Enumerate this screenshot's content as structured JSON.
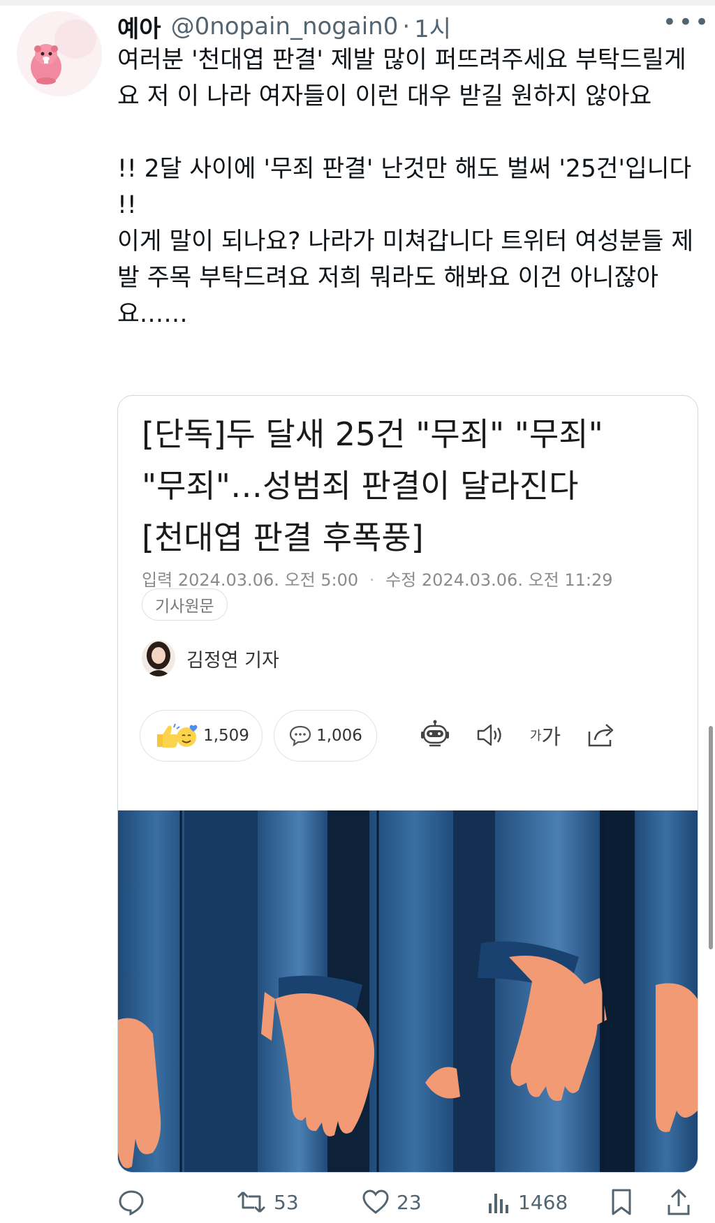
{
  "tweet": {
    "author_name": "예아",
    "handle": "@0nopain_nogain0",
    "separator": "·",
    "time": "1시",
    "more": "•••",
    "paragraphs": [
      "여러분 '천대엽 판결' 제발 많이 퍼뜨려주세요 부탁드릴게요 저 이 나라 여자들이 이런 대우 받길 원하지 않아요",
      "",
      "!! 2달 사이에 '무죄 판결' 난것만 해도 벌써 '25건'입니다 !!",
      "이게 말이 되나요? 나라가 미쳐갑니다 트위터 여성분들 제발 주목 부탁드려요 저희 뭐라도 해봐요 이건 아니잖아요……"
    ]
  },
  "article": {
    "headline_lines": [
      "[단독]두 달새 25건 \"무죄\" \"무죄\"",
      "\"무죄\"…성범죄 판결이 달라진다",
      "[천대엽 판결 후폭풍]"
    ],
    "input_label": "입력",
    "input_time": "2024.03.06. 오전 5:00",
    "modified_label": "수정",
    "modified_time": "2024.03.06. 오전 11:29",
    "original_chip": "기사원문",
    "reporter": "김정연 기자",
    "reactions": "1,509",
    "comments": "1,006",
    "font_size_label_small": "가",
    "font_size_label_big": "가"
  },
  "actions": {
    "replies": "",
    "retweets": "53",
    "likes": "23",
    "views": "1468"
  },
  "colors": {
    "text": "#0f1419",
    "secondary": "#536471",
    "border": "#cfd9de",
    "illustration_bg": "#10243f",
    "suit_blue": "#2b5c8c",
    "skin": "#f19a73"
  }
}
